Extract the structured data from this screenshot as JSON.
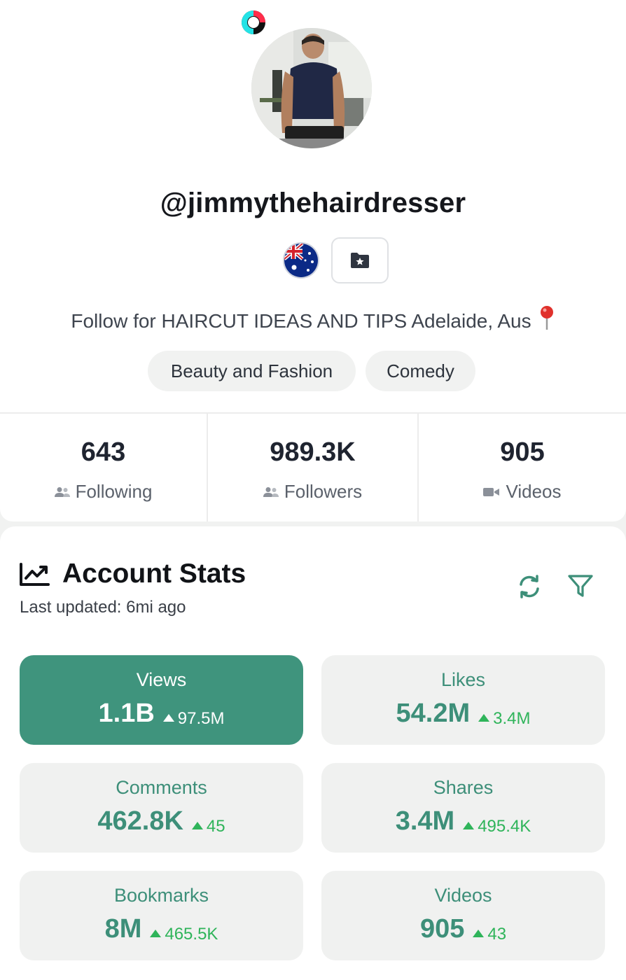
{
  "profile": {
    "username": "@jimmythehairdresser",
    "avatar_icon": "profile-photo",
    "badges": [
      "tiktok-ring-icon",
      "australia-flag-icon",
      "folder-star-icon"
    ],
    "bio": "Follow for HAIRCUT IDEAS AND TIPS Adelaide, Aus",
    "bio_icon": "map-pin-icon",
    "categories": [
      "Beauty and Fashion",
      "Comedy"
    ]
  },
  "counts": [
    {
      "value": "643",
      "label": "Following",
      "icon": "people-icon"
    },
    {
      "value": "989.3K",
      "label": "Followers",
      "icon": "people-icon"
    },
    {
      "value": "905",
      "label": "Videos",
      "icon": "video-camera-icon"
    }
  ],
  "account_stats": {
    "title": "Account Stats",
    "last_updated": "Last updated: 6mi ago",
    "icons": {
      "title": "line-chart-icon",
      "refresh": "refresh-icon",
      "filter": "filter-icon"
    },
    "tiles": [
      {
        "label": "Views",
        "value": "1.1B",
        "delta": "97.5M",
        "active": true
      },
      {
        "label": "Likes",
        "value": "54.2M",
        "delta": "3.4M",
        "active": false
      },
      {
        "label": "Comments",
        "value": "462.8K",
        "delta": "45",
        "active": false
      },
      {
        "label": "Shares",
        "value": "3.4M",
        "delta": "495.4K",
        "active": false
      },
      {
        "label": "Bookmarks",
        "value": "8M",
        "delta": "465.5K",
        "active": false
      },
      {
        "label": "Videos",
        "value": "905",
        "delta": "43",
        "active": false
      }
    ]
  },
  "colors": {
    "accent": "#3f947d",
    "accent_text": "#3d8f79",
    "increase": "#2fb45a",
    "tile_bg": "#f0f1f0"
  }
}
